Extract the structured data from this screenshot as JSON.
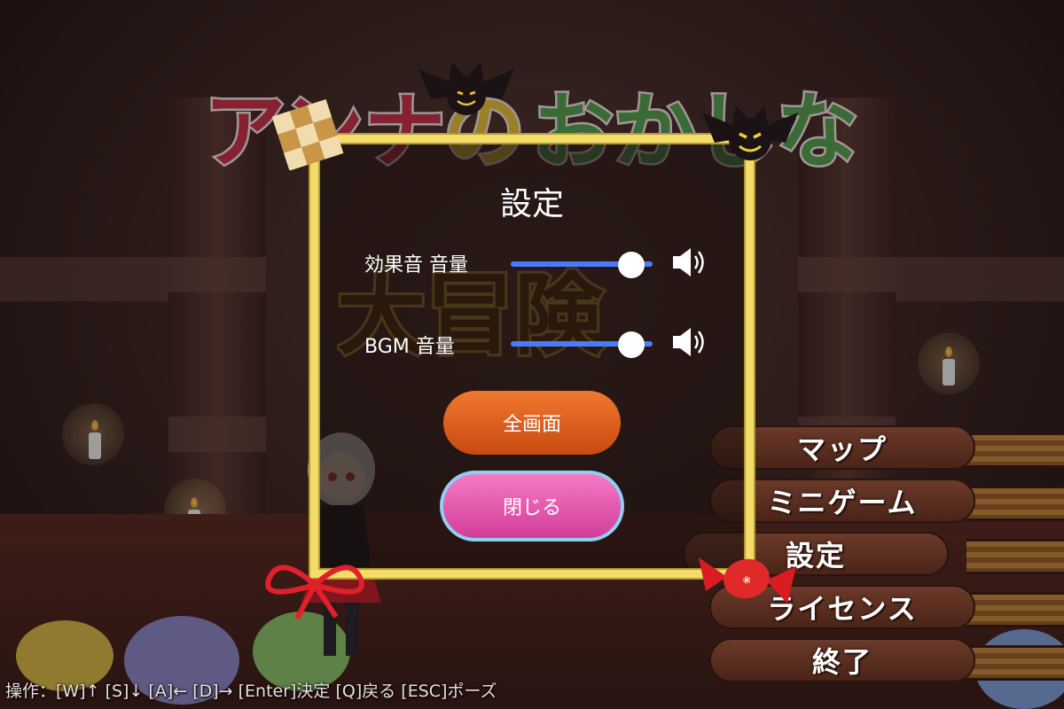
{
  "game_title_art": "アンナのおかしな大冒険",
  "dialog": {
    "title": "設定",
    "settings": [
      {
        "label": "効果音 音量",
        "value": 0.93
      },
      {
        "label": "BGM 音量",
        "value": 0.93
      }
    ],
    "fullscreen_label": "全画面",
    "close_label": "閉じる"
  },
  "side_menu": {
    "items": [
      "マップ",
      "ミニゲーム",
      "設定",
      "ライセンス",
      "終了"
    ]
  },
  "hint": "操作：[W]↑ [S]↓ [A]← [D]→ [Enter]決定 [Q]戻る [ESC]ポーズ",
  "colors": {
    "frame": "#f3dc6a",
    "slider_track": "#4a7bff",
    "fullscreen_button": "#e0621c",
    "close_button": "#e45aae",
    "close_button_outline": "#8fd0f0",
    "menu_button": "#5a2e20"
  },
  "icons": [
    "speaker-icon",
    "bat-icon",
    "cookie-icon",
    "candy-icon",
    "ribbon-icon",
    "candle-icon"
  ]
}
